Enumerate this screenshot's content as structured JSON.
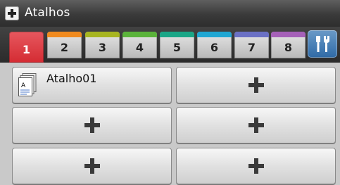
{
  "header": {
    "title": "Atalhos",
    "icon": "add-shortcut-icon"
  },
  "tabs": [
    {
      "label": "1",
      "color": "#e0383f",
      "active": true
    },
    {
      "label": "2",
      "color": "#f08a1e",
      "active": false
    },
    {
      "label": "3",
      "color": "#a7b520",
      "active": false
    },
    {
      "label": "4",
      "color": "#5ab33a",
      "active": false
    },
    {
      "label": "5",
      "color": "#1aa687",
      "active": false
    },
    {
      "label": "6",
      "color": "#1fa6d2",
      "active": false
    },
    {
      "label": "7",
      "color": "#6a70c4",
      "active": false
    },
    {
      "label": "8",
      "color": "#a560b8",
      "active": false
    }
  ],
  "settings": {
    "icon": "tools-icon",
    "color": "#3d78b3"
  },
  "shortcuts": [
    {
      "label": "Atalho01",
      "icon": "document-icon"
    },
    {
      "label": "",
      "icon": "plus-icon"
    },
    {
      "label": "",
      "icon": "plus-icon"
    },
    {
      "label": "",
      "icon": "plus-icon"
    },
    {
      "label": "",
      "icon": "plus-icon"
    },
    {
      "label": "",
      "icon": "plus-icon"
    }
  ]
}
